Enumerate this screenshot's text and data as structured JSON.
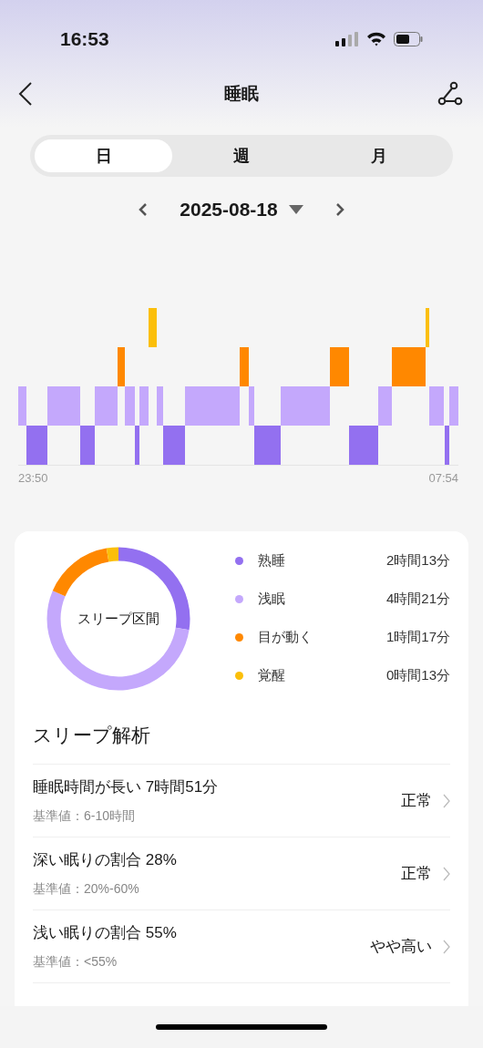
{
  "status_bar": {
    "time": "16:53"
  },
  "header": {
    "title": "睡眠"
  },
  "tabs": [
    {
      "label": "日",
      "selected": true
    },
    {
      "label": "週",
      "selected": false
    },
    {
      "label": "月",
      "selected": false
    }
  ],
  "date_picker": {
    "date": "2025-08-18"
  },
  "hypnogram": {
    "start_time": "23:50",
    "end_time": "07:54"
  },
  "sleep_summary": {
    "center_label": "スリープ区間",
    "legend": [
      {
        "label": "熟睡",
        "duration": "2時間13分",
        "color": "#9370f0"
      },
      {
        "label": "浅眠",
        "duration": "4時間21分",
        "color": "#c4a8fc"
      },
      {
        "label": "目が動く",
        "duration": "1時間17分",
        "color": "#ff8800"
      },
      {
        "label": "覚醒",
        "duration": "0時間13分",
        "color": "#fbbf0a"
      }
    ]
  },
  "analysis": {
    "title": "スリープ解析",
    "rows": [
      {
        "title": "睡眠時間が長い 7時間51分",
        "reference": "基準値：6-10時間",
        "status": "正常"
      },
      {
        "title": "深い眠りの割合 28%",
        "reference": "基準値：20%-60%",
        "status": "正常"
      },
      {
        "title": "浅い眠りの割合 55%",
        "reference": "基準値：<55%",
        "status": "やや高い"
      }
    ]
  }
}
